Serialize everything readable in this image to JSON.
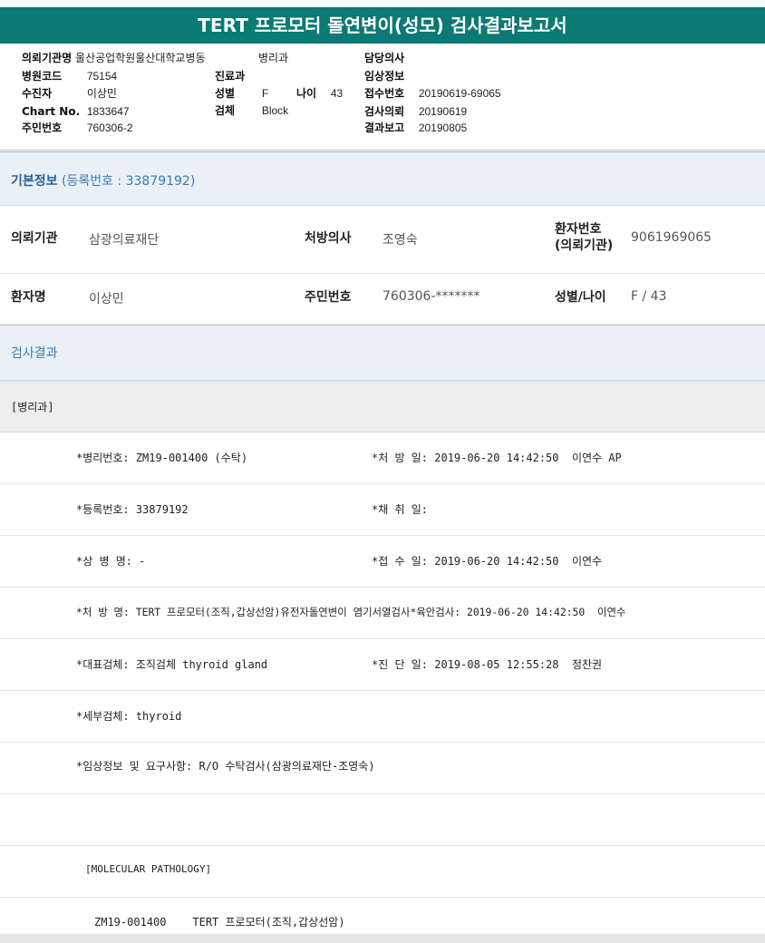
{
  "report_title": "TERT 프로모터 돌연변이(성모) 검사결과보고서",
  "header": {
    "col1": [
      {
        "key": "의뢰기관명",
        "value": "울산공업학원울산대학교병동"
      },
      {
        "key": "병원코드",
        "value": "75154"
      },
      {
        "key": "수진자",
        "value": "이상민"
      },
      {
        "key": "Chart No.",
        "value": "1833647"
      },
      {
        "key": "주민번호",
        "value": "760306-2"
      }
    ],
    "col2": [
      {
        "key": "",
        "value": "병리과"
      },
      {
        "key": "진료과",
        "value": ""
      },
      {
        "key": "성별",
        "value": "F"
      },
      {
        "key": "검체",
        "value": "Block"
      }
    ],
    "age": {
      "key": "나이",
      "value": "43"
    },
    "col3": [
      {
        "key": "담당의사",
        "value": ""
      },
      {
        "key": "임상정보",
        "value": ""
      },
      {
        "key": "접수번호",
        "value": "20190619-69065"
      },
      {
        "key": "검사의뢰",
        "value": "20190619"
      },
      {
        "key": "결과보고",
        "value": "20190805"
      }
    ]
  },
  "basic_info": {
    "heading": "기본정보",
    "reg_text": "(등록번호 : 33879192)",
    "rows": [
      [
        {
          "label": "의뢰기관",
          "value": "삼광의료재단"
        },
        {
          "label": "처방의사",
          "value": "조영숙"
        },
        {
          "label_line1": "환자번호",
          "label_line2": "(의뢰기관)",
          "value": "9061969065"
        }
      ],
      [
        {
          "label": "환자명",
          "value": "이상민"
        },
        {
          "label": "주민번호",
          "value": "760306-*******"
        },
        {
          "label": "성별/나이",
          "value": "F / 43"
        }
      ]
    ]
  },
  "results": {
    "heading": "검사결과",
    "department": "[병리과]",
    "lines": [
      {
        "left": "*병리번호: ZM19-001400 (수탁)",
        "right": "*처 방 일: 2019-06-20 14:42:50  이연수 AP"
      },
      {
        "left": "*등록번호: 33879192",
        "right": "*채 취 일:"
      },
      {
        "left": "*상 병 명: -",
        "right": "*접 수 일: 2019-06-20 14:42:50  이연수"
      },
      {
        "left": "*처 방 명: TERT 프로모터(조직,갑상선암)유전자돌연변이 염기서열검사*육안검사: 2019-06-20 14:42:50  이연수",
        "right": ""
      },
      {
        "left": "*대표검체: 조직검체 thyroid gland",
        "right": "*진 단 일: 2019-08-05 12:55:28  정찬권"
      },
      {
        "left": "*세부검체: thyroid",
        "right": ""
      },
      {
        "left": "*임상정보 및 요구사항: R/O 수탁검사(삼광의료재단-조영숙)",
        "right": ""
      },
      {
        "left": "",
        "right": ""
      }
    ],
    "molecular_header": "[MOLECULAR PATHOLOGY]",
    "molecular_line": "ZM19-001400    TERT 프로모터(조직,갑상선암)"
  }
}
